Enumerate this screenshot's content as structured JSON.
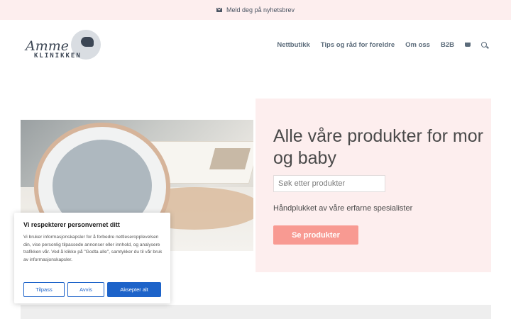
{
  "topbar": {
    "newsletter_text": "Meld deg på nyhetsbrev",
    "icon": "envelope-icon"
  },
  "logo": {
    "line1": "Amme",
    "line2": "KLINIKKEN"
  },
  "nav": {
    "items": [
      "Nettbutikk",
      "Tips og råd for foreldre",
      "Om oss",
      "B2B"
    ],
    "cart_icon": "cart-icon",
    "search_icon": "search-icon"
  },
  "hero": {
    "heading": "Alle våre produkter for mor og baby",
    "search_placeholder": "Søk etter produkter",
    "tagline": "Håndplukket av våre erfarne spesialister",
    "button": "Se produkter"
  },
  "cookie": {
    "title": "Vi respekterer personvernet ditt",
    "body": "Vi bruker informasjonskapsler for å forbedre nettleseropplevelsen din, vise personlig tilpassede annonser eller innhold, og analysere trafikken vår. Ved å klikke på \"Godta alle\", samtykker du til vår bruk av informasjonskapsler.",
    "btn_customize": "Tilpass",
    "btn_reject": "Avvis",
    "btn_accept": "Aksepter alt"
  },
  "colors": {
    "accent": "#f89a92",
    "pink_bg": "#fdeeee",
    "cookie_blue": "#1d63c9"
  }
}
